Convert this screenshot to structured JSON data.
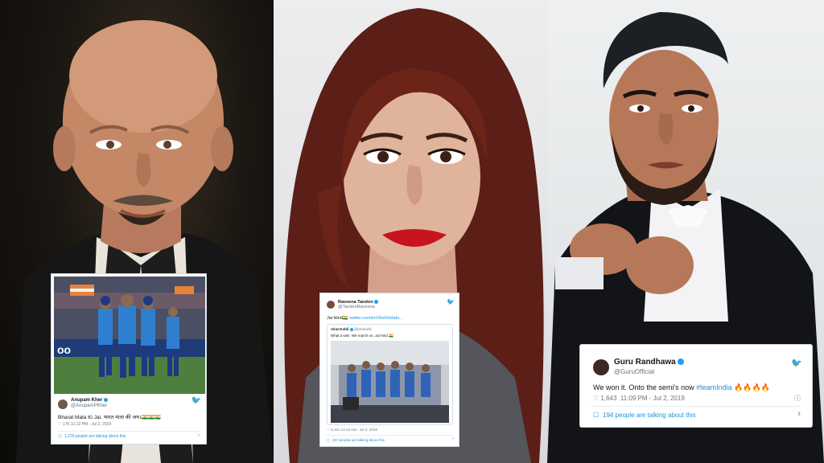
{
  "tweets": [
    {
      "name": "Anupam Kher",
      "handle": "@AnupamPKher",
      "text": "Bharat Mata Ki Jai. भारत माता की जय।🇮🇳🇮🇳🇮🇳",
      "meta": "♡ 17K   11:12 PM - Jul 2, 2019",
      "talking": "1,229 people are talking about this"
    },
    {
      "name": "Raveena Tandon",
      "handle": "@TandonRaveena",
      "text": "Jai Hind🇮🇳",
      "link": "twitter.com/imVkohli/statu...",
      "quoted_name": "Virat Kohli",
      "quoted_handle": "@imVkohli",
      "quoted_text": "What a win!. We march on. Jai hind 🇮🇳",
      "meta": "♡ 5,151   12:13 AM - Jul 3, 2019",
      "talking": "207 people are talking about this"
    },
    {
      "name": "Guru Randhawa",
      "handle": "@GuruOfficial",
      "text": "We won it. Onto the semi's now",
      "hashtag": "#teamIndia",
      "emoji": "🔥🔥🔥🔥",
      "likes": "♡ 1,643",
      "meta": "11:09 PM - Jul 2, 2019",
      "talking": "194 people are talking about this"
    }
  ],
  "icons": {
    "twitter": "bird-icon",
    "info": "info-icon",
    "chevron": "chevron-right-icon",
    "comment": "speech-bubble-icon"
  }
}
